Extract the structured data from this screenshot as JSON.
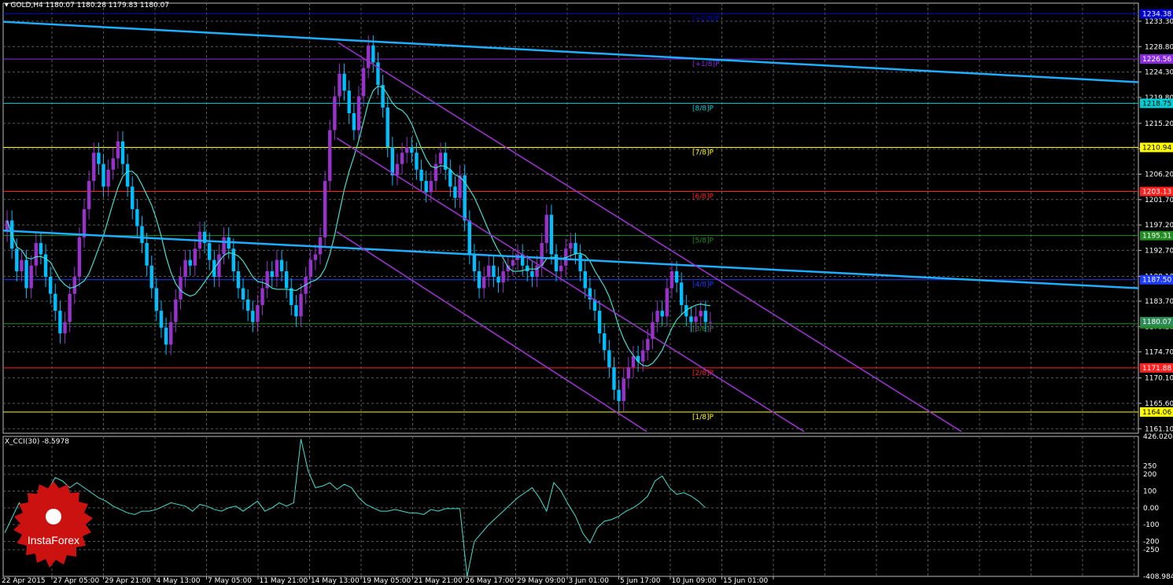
{
  "header": {
    "symbol": "GOLD,H4",
    "ohlc": "1180.07 1180.28 1179.83 1180.07"
  },
  "cci_header": "X_CCI(30) -8.5978",
  "brand": "InstaForex",
  "colors": {
    "bull": "#9932CC",
    "bear": "#00BFFF",
    "ma": "#40E0D0",
    "trend": "#1EAEFF",
    "channel": "#9932CC",
    "grid": "#5a5a5a",
    "cci": "#40E0D0"
  },
  "chart_data": {
    "type": "candlestick",
    "ylim": [
      1160.3,
      1236.5
    ],
    "price_ticks": [
      "1233.30",
      "1228.80",
      "1224.30",
      "1219.80",
      "1215.20",
      "1210.70",
      "1206.20",
      "1201.70",
      "1197.20",
      "1192.70",
      "1188.10",
      "1183.70",
      "1179.20",
      "1174.70",
      "1170.10",
      "1165.60",
      "1161.10"
    ],
    "x_labels": [
      "22 Apr 2015",
      "27 Apr 05:00",
      "29 Apr 21:00",
      "4 May 13:00",
      "7 May 05:00",
      "11 May 21:00",
      "14 May 13:00",
      "19 May 05:00",
      "21 May 21:00",
      "26 May 17:00",
      "29 May 09:00",
      "3 Jun 01:00",
      "5 Jun 17:00",
      "10 Jun 09:00",
      "15 Jun 01:00"
    ],
    "murrey_levels": [
      {
        "label": "[+2/8]P",
        "price": 1234.6,
        "color": "#0000CD",
        "tag": "1234.38"
      },
      {
        "label": "[+1/8]P",
        "price": 1226.6,
        "color": "#8A2BE2",
        "tag": "1226.56"
      },
      {
        "label": "[8/8]P",
        "price": 1218.75,
        "color": "#00CED1",
        "tag": "1218.75"
      },
      {
        "label": "[7/8]P",
        "price": 1210.94,
        "color": "#FFFF00",
        "tag": "1210.94"
      },
      {
        "label": "[6/8]P",
        "price": 1203.13,
        "color": "#FF2020",
        "tag": "1203.13"
      },
      {
        "label": "[5/8]P",
        "price": 1195.31,
        "color": "#228B22",
        "tag": "1195.31"
      },
      {
        "label": "[4/8]P",
        "price": 1187.5,
        "color": "#1E3CFF",
        "tag": "1187.50"
      },
      {
        "label": "[3/8]P",
        "price": 1179.69,
        "color": "#228B22",
        "tag": "1179.69"
      },
      {
        "label": "[2/8]P",
        "price": 1171.88,
        "color": "#FF2020",
        "tag": "1171.88"
      },
      {
        "label": "[1/8]P",
        "price": 1164.06,
        "color": "#FFFF00",
        "tag": "1164.06"
      }
    ],
    "current_price": "1180.07",
    "close": [
      1198,
      1193,
      1189,
      1191,
      1186,
      1190,
      1194,
      1192,
      1188,
      1185,
      1182,
      1178,
      1180,
      1185,
      1188,
      1195,
      1200,
      1205,
      1210,
      1208,
      1204,
      1207,
      1209,
      1212,
      1208,
      1204,
      1200,
      1197,
      1194,
      1190,
      1186,
      1182,
      1179,
      1176,
      1180,
      1184,
      1188,
      1191,
      1190,
      1193,
      1196,
      1194,
      1191,
      1188,
      1192,
      1195,
      1193,
      1189,
      1186,
      1184,
      1182,
      1180,
      1183,
      1186,
      1189,
      1188,
      1191,
      1189,
      1186,
      1183,
      1181,
      1185,
      1188,
      1191,
      1192,
      1195,
      1205,
      1214,
      1220,
      1224,
      1221,
      1217,
      1214,
      1220,
      1225,
      1229,
      1226,
      1222,
      1218,
      1211,
      1206,
      1208,
      1210,
      1211,
      1210,
      1207,
      1205,
      1203,
      1205,
      1208,
      1210,
      1207,
      1204,
      1202,
      1206,
      1198,
      1192,
      1189,
      1186,
      1188,
      1190,
      1188,
      1187,
      1189,
      1190,
      1191,
      1192,
      1190,
      1189,
      1188,
      1190,
      1194,
      1199,
      1192,
      1189,
      1190,
      1193,
      1194,
      1192,
      1189,
      1186,
      1184,
      1182,
      1178,
      1175,
      1172,
      1168,
      1166,
      1170,
      1172,
      1174,
      1173,
      1175,
      1177,
      1180,
      1182,
      1181,
      1186,
      1189,
      1187,
      1183,
      1181,
      1180,
      1181,
      1182,
      1180,
      1180
    ]
  },
  "cci_data": {
    "ylim": [
      -408.9843,
      426.0204
    ],
    "ticks": [
      "426.0204",
      "250",
      "200",
      "100",
      "0.00",
      "-100",
      "-200",
      "-250",
      "-408.9843"
    ],
    "values": [
      -150,
      -60,
      30,
      -20,
      -80,
      20,
      110,
      180,
      160,
      120,
      150,
      120,
      90,
      60,
      40,
      10,
      -10,
      -30,
      -40,
      -20,
      -20,
      -10,
      10,
      30,
      20,
      10,
      -20,
      20,
      10,
      -10,
      -20,
      0,
      10,
      -20,
      10,
      40,
      -20,
      0,
      30,
      10,
      30,
      410,
      220,
      120,
      130,
      150,
      110,
      140,
      120,
      60,
      20,
      0,
      -20,
      -20,
      -10,
      -20,
      -30,
      -30,
      -40,
      -10,
      -20,
      -5,
      -5,
      -5,
      -410,
      -200,
      -150,
      -100,
      -60,
      -20,
      20,
      60,
      90,
      120,
      60,
      -20,
      150,
      100,
      20,
      -50,
      -150,
      -210,
      -120,
      -80,
      -70,
      -50,
      -20,
      0,
      30,
      70,
      160,
      190,
      120,
      80,
      90,
      70,
      40,
      0
    ]
  }
}
